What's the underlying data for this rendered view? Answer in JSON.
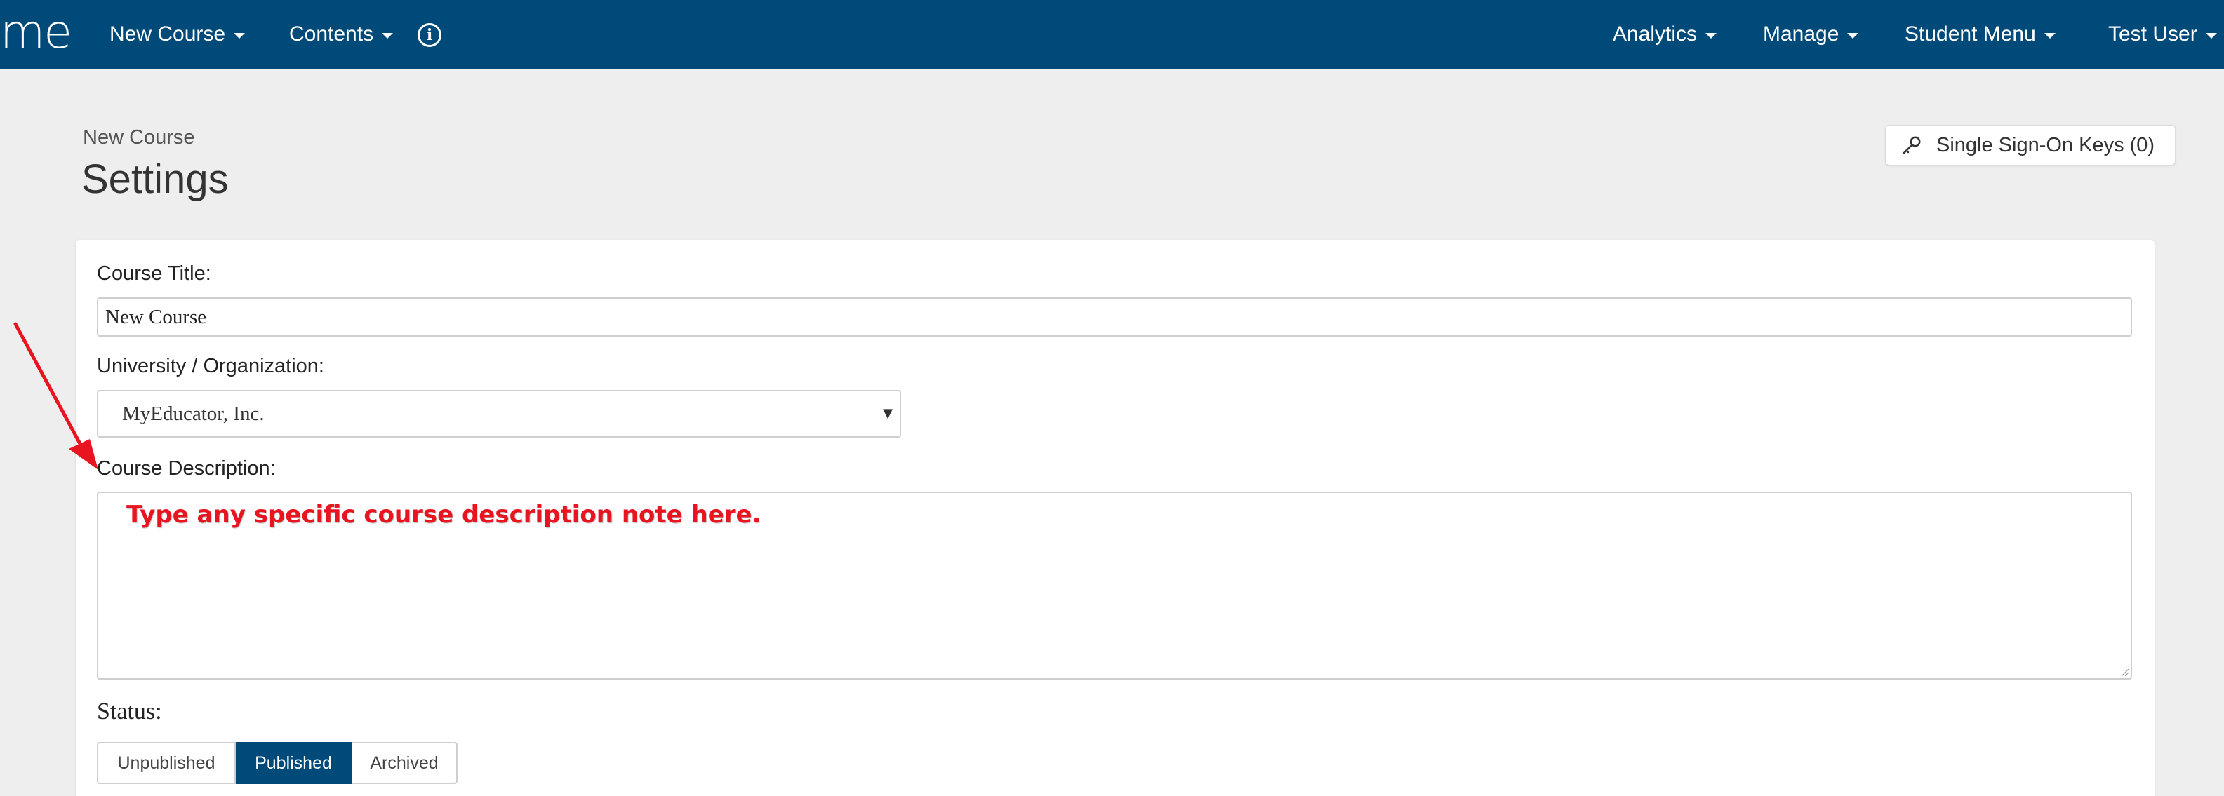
{
  "navbar": {
    "brand": "me",
    "left_items": [
      {
        "label": "New Course"
      },
      {
        "label": "Contents"
      }
    ],
    "info_icon": "info-circle-icon",
    "right_items": [
      {
        "label": "Analytics"
      },
      {
        "label": "Manage"
      },
      {
        "label": "Student Menu"
      },
      {
        "label": "Test User"
      }
    ],
    "background_color": "#004a7a"
  },
  "header": {
    "breadcrumb": "New Course",
    "title": "Settings",
    "sso_button": {
      "icon": "key-icon",
      "label": "Single Sign-On Keys (0)"
    }
  },
  "form": {
    "course_title": {
      "label": "Course Title:",
      "value": "New Course"
    },
    "organization": {
      "label": "University / Organization:",
      "selected": "MyEducator, Inc."
    },
    "description": {
      "label": "Course Description:",
      "annotation": "Type any specific course description note here.",
      "annotation_color": "#e8141f"
    },
    "status": {
      "label": "Status:",
      "options": [
        {
          "label": "Unpublished",
          "active": false
        },
        {
          "label": "Published",
          "active": true
        },
        {
          "label": "Archived",
          "active": false
        }
      ],
      "active_color": "#004a7a"
    }
  }
}
